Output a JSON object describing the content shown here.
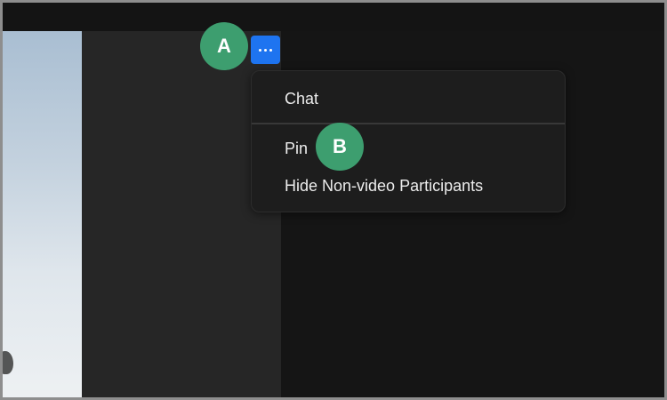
{
  "colors": {
    "background": "#151515",
    "tile": "#262626",
    "menu": "#1d1d1d",
    "accent_button": "#1e74f0",
    "callout": "#3d9e6f",
    "menu_text": "#ececec"
  },
  "toolbar": {
    "more_button_icon": "more-dots-icon"
  },
  "menu": {
    "items": [
      {
        "label": "Chat"
      },
      {
        "label": "Pin"
      },
      {
        "label": "Hide Non-video Participants"
      }
    ]
  },
  "callouts": {
    "a": "A",
    "b": "B"
  }
}
